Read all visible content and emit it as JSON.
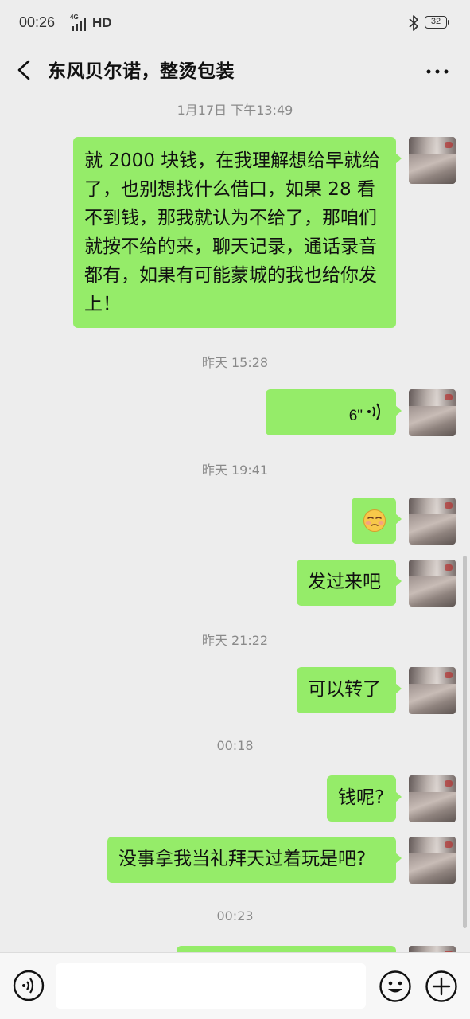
{
  "status_bar": {
    "time": "00:26",
    "network_label": "4G",
    "signal": "HD",
    "battery": "32"
  },
  "header": {
    "title": "东风贝尔诺，整烫包装"
  },
  "messages": [
    {
      "timestamp": "1月17日 下午13:49"
    },
    {
      "text": "就 2000 块钱，在我理解想给早就给了，也别想找什么借口，如果 28 看不到钱，那我就认为不给了，那咱们就按不给的来，聊天记录，通话录音都有，如果有可能蒙城的我也给你发上！"
    },
    {
      "timestamp": "昨天 15:28"
    },
    {
      "voice_duration": "6\""
    },
    {
      "timestamp": "昨天 19:41"
    },
    {
      "emoji": "smirk-face"
    },
    {
      "text": "发过来吧"
    },
    {
      "timestamp": "昨天 21:22"
    },
    {
      "text": "可以转了"
    },
    {
      "timestamp": "00:18"
    },
    {
      "text": "钱呢?"
    },
    {
      "text": "没事拿我当礼拜天过着玩是吧?"
    },
    {
      "timestamp": "00:23"
    }
  ],
  "colors": {
    "background": "#ededed",
    "bubble": "#95ec69",
    "timestamp": "#8a8a8a"
  }
}
